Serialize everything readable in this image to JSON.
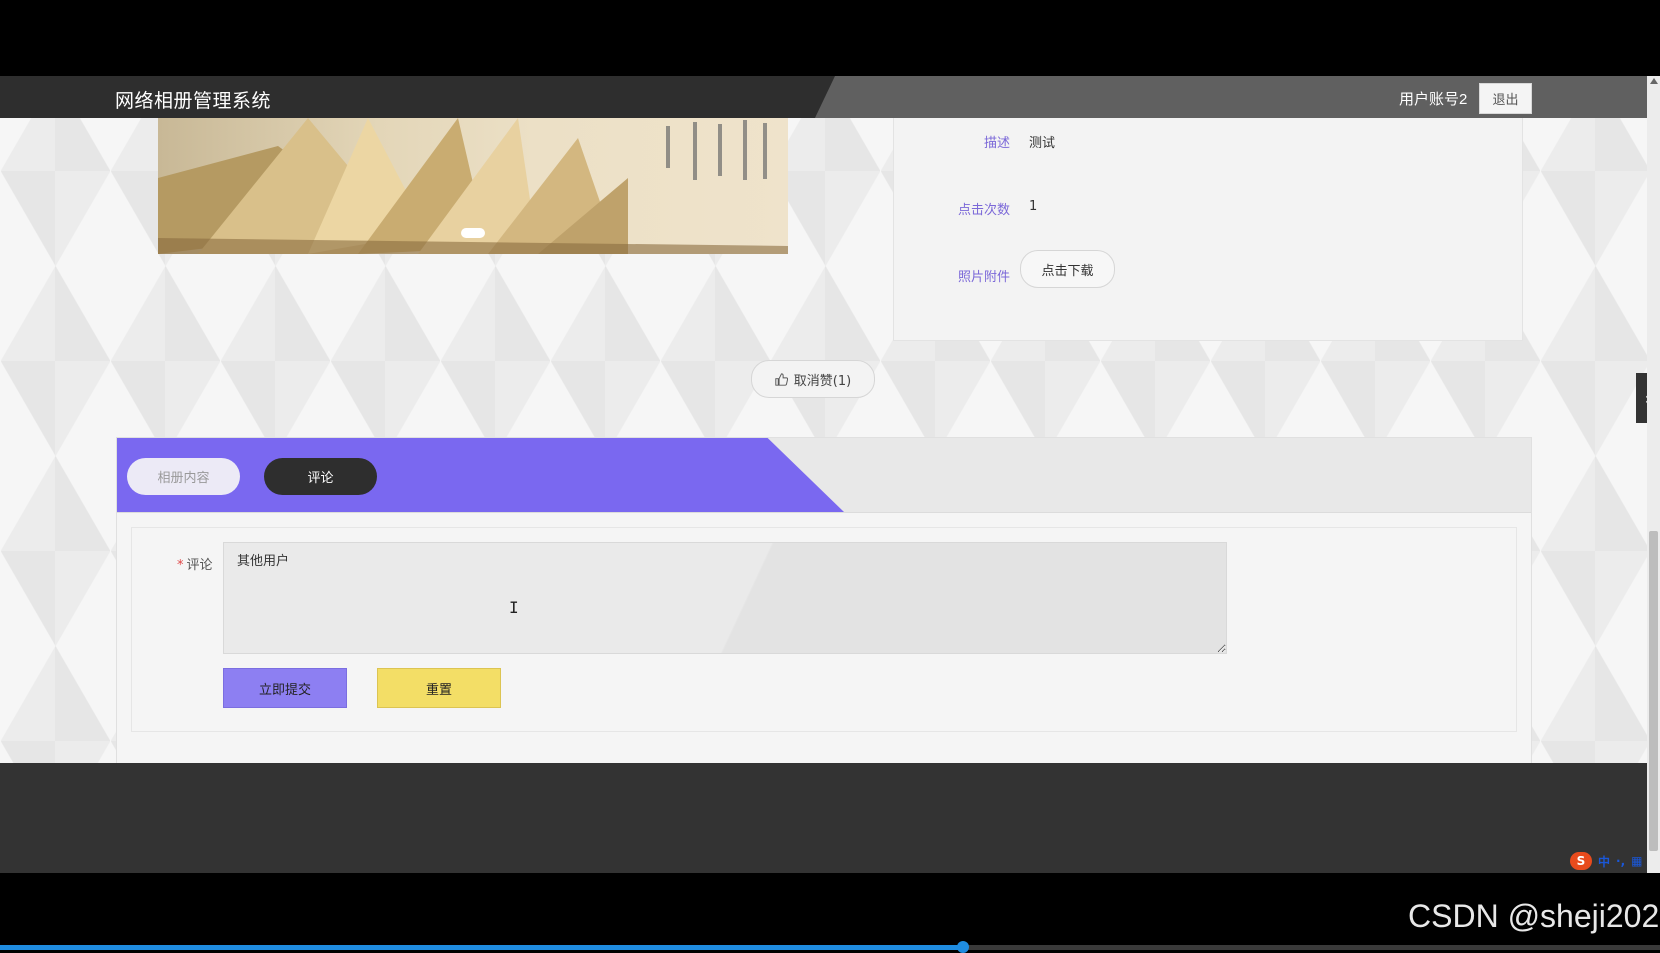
{
  "header": {
    "site_title": "网络相册管理系统",
    "username": "用户账号2",
    "logout_label": "退出"
  },
  "details": {
    "description_label": "描述",
    "description_value": "测试",
    "clicks_label": "点击次数",
    "clicks_value": "1",
    "attachment_label": "照片附件",
    "download_label": "点击下载"
  },
  "like": {
    "label": "取消赞(1)",
    "icon": "thumbs-up-icon"
  },
  "tabs": [
    {
      "label": "相册内容",
      "active": false
    },
    {
      "label": "评论",
      "active": true
    }
  ],
  "comment_form": {
    "label": "评论",
    "value": "其他用户",
    "submit_label": "立即提交",
    "reset_label": "重置"
  },
  "ime": {
    "item1": "中",
    "item2": "·,",
    "item3": "▦"
  },
  "watermark": "CSDN @sheji202",
  "video_progress": 0.58,
  "colors": {
    "accent": "#7a68f0",
    "submit": "#8d7ff2",
    "reset": "#f3de66",
    "header_dark": "#2e2e2e"
  }
}
